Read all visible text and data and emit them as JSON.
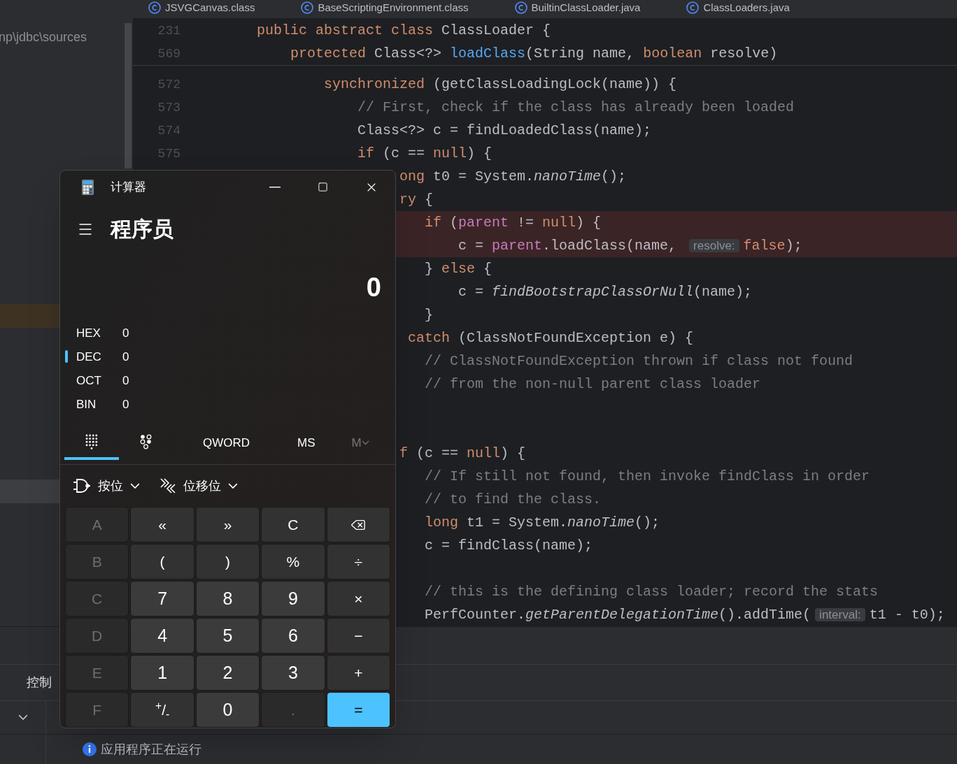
{
  "editor_tabs": [
    {
      "label": "JSVGCanvas.class",
      "selected": false
    },
    {
      "label": "BaseScriptingEnvironment.class",
      "selected": false
    },
    {
      "label": "BuiltinClassLoader.java",
      "selected": false
    },
    {
      "label": "ClassLoaders.java",
      "selected": false
    }
  ],
  "project_panel": {
    "path": "np\\jdbc\\sources"
  },
  "sticky_lines": [
    {
      "number": "231",
      "tokens": [
        {
          "text": "public abstract class ",
          "kind": "kw"
        },
        {
          "text": "ClassLoader {",
          "kind": "plain"
        }
      ]
    },
    {
      "number": "569",
      "tokens": [
        {
          "text": "    protected ",
          "kind": "kw"
        },
        {
          "text": "Class<?> ",
          "kind": "plain"
        },
        {
          "text": "loadClass",
          "kind": "call"
        },
        {
          "text": "(String name, ",
          "kind": "plain"
        },
        {
          "text": "boolean ",
          "kind": "kw"
        },
        {
          "text": "resolve)",
          "kind": "plain"
        }
      ]
    }
  ],
  "code_lines": [
    {
      "number": "572",
      "highlighted": false,
      "tokens": [
        {
          "text": "        synchronized ",
          "kind": "kw"
        },
        {
          "text": "(getClassLoadingLock(name)) {",
          "kind": "plain"
        }
      ]
    },
    {
      "number": "573",
      "highlighted": false,
      "tokens": [
        {
          "text": "            // First, check if the class has already been loaded",
          "kind": "comment"
        }
      ]
    },
    {
      "number": "574",
      "highlighted": false,
      "tokens": [
        {
          "text": "            Class<?> c = findLoadedClass(name);",
          "kind": "plain"
        }
      ]
    },
    {
      "number": "575",
      "highlighted": false,
      "tokens": [
        {
          "text": "            if ",
          "kind": "kw"
        },
        {
          "text": "(c == ",
          "kind": "plain"
        },
        {
          "text": "null",
          "kind": "kw"
        },
        {
          "text": ") {",
          "kind": "plain"
        }
      ]
    },
    {
      "highlighted": false,
      "tokens": [
        {
          "text": "                 ong ",
          "kind": "kw"
        },
        {
          "text": "t0 = System.",
          "kind": "plain"
        },
        {
          "text": "nanoTime",
          "kind": "static"
        },
        {
          "text": "();",
          "kind": "plain"
        }
      ]
    },
    {
      "highlighted": false,
      "tokens": [
        {
          "text": "                 ry ",
          "kind": "kw"
        },
        {
          "text": "{",
          "kind": "plain"
        }
      ]
    },
    {
      "highlighted": true,
      "tokens": [
        {
          "text": "                    if ",
          "kind": "kw"
        },
        {
          "text": "(",
          "kind": "plain"
        },
        {
          "text": "parent",
          "kind": "field"
        },
        {
          "text": " != ",
          "kind": "plain"
        },
        {
          "text": "null",
          "kind": "kw"
        },
        {
          "text": ") {",
          "kind": "plain"
        }
      ]
    },
    {
      "highlighted": true,
      "tokens": [
        {
          "text": "                        c = ",
          "kind": "plain"
        },
        {
          "text": "parent",
          "kind": "field"
        },
        {
          "text": ".loadClass(name, ",
          "kind": "plain"
        },
        {
          "text": "resolve:",
          "kind": "hint"
        },
        {
          "text": "false",
          "kind": "kw"
        },
        {
          "text": ");",
          "kind": "plain"
        }
      ]
    },
    {
      "highlighted": false,
      "tokens": [
        {
          "text": "                    } ",
          "kind": "plain"
        },
        {
          "text": "else ",
          "kind": "kw"
        },
        {
          "text": "{",
          "kind": "plain"
        }
      ]
    },
    {
      "highlighted": false,
      "tokens": [
        {
          "text": "                        c = ",
          "kind": "plain"
        },
        {
          "text": "findBootstrapClassOrNull",
          "kind": "static"
        },
        {
          "text": "(name);",
          "kind": "plain"
        }
      ]
    },
    {
      "highlighted": false,
      "tokens": [
        {
          "text": "                    }",
          "kind": "plain"
        }
      ]
    },
    {
      "highlighted": false,
      "tokens": [
        {
          "text": "                  catch ",
          "kind": "kw"
        },
        {
          "text": "(ClassNotFoundException e) {",
          "kind": "plain"
        }
      ]
    },
    {
      "highlighted": false,
      "tokens": [
        {
          "text": "                    // ClassNotFoundException thrown if class not found",
          "kind": "comment"
        }
      ]
    },
    {
      "highlighted": false,
      "tokens": [
        {
          "text": "                    // from the non-null parent class loader",
          "kind": "comment"
        }
      ]
    },
    {
      "highlighted": false
    },
    {
      "highlighted": false
    },
    {
      "highlighted": false,
      "tokens": [
        {
          "text": "                 f ",
          "kind": "kw"
        },
        {
          "text": "(c == ",
          "kind": "plain"
        },
        {
          "text": "null",
          "kind": "kw"
        },
        {
          "text": ") {",
          "kind": "plain"
        }
      ]
    },
    {
      "highlighted": false,
      "tokens": [
        {
          "text": "                    // If still not found, then invoke findClass in order",
          "kind": "comment"
        }
      ]
    },
    {
      "highlighted": false,
      "tokens": [
        {
          "text": "                    // to find the class.",
          "kind": "comment"
        }
      ]
    },
    {
      "highlighted": false,
      "tokens": [
        {
          "text": "                    long ",
          "kind": "kw"
        },
        {
          "text": "t1 = System.",
          "kind": "plain"
        },
        {
          "text": "nanoTime",
          "kind": "static"
        },
        {
          "text": "();",
          "kind": "plain"
        }
      ]
    },
    {
      "highlighted": false,
      "tokens": [
        {
          "text": "                    c = findClass(name);",
          "kind": "plain"
        }
      ]
    },
    {
      "highlighted": false
    },
    {
      "highlighted": false,
      "tokens": [
        {
          "text": "                    // this is the defining class loader; record the stats",
          "kind": "comment"
        }
      ]
    },
    {
      "highlighted": false,
      "tokens": [
        {
          "text": "                    PerfCounter.",
          "kind": "plain"
        },
        {
          "text": "getParentDelegationTime",
          "kind": "static"
        },
        {
          "text": "().addTime(",
          "kind": "plain"
        },
        {
          "text": "interval:",
          "kind": "hint"
        },
        {
          "text": "t1 - t0);",
          "kind": "plain"
        }
      ]
    }
  ],
  "console": {
    "tab": "控制",
    "status": "应用程序正在运行"
  },
  "calculator": {
    "title": "计算器",
    "mode": "程序员",
    "display": "0",
    "radix": [
      {
        "label": "HEX",
        "value": "0",
        "selected": false
      },
      {
        "label": "DEC",
        "value": "0",
        "selected": true
      },
      {
        "label": "OCT",
        "value": "0",
        "selected": false
      },
      {
        "label": "BIN",
        "value": "0",
        "selected": false
      }
    ],
    "views": [
      {
        "kind": "keypad",
        "selected": true
      },
      {
        "kind": "bits",
        "selected": false
      }
    ],
    "word_size": "QWORD",
    "memory_buttons": [
      {
        "label": "MS",
        "kind": "button",
        "disabled": false
      },
      {
        "label": "M",
        "kind": "menu",
        "disabled": true
      }
    ],
    "menus": [
      {
        "kind": "bitwise",
        "label": "按位"
      },
      {
        "kind": "shift",
        "label": "位移位"
      }
    ],
    "keys": [
      {
        "label": "A",
        "kind": "digit",
        "disabled": true
      },
      {
        "label": "«",
        "kind": "op",
        "disabled": false
      },
      {
        "label": "»",
        "kind": "op",
        "disabled": false
      },
      {
        "label": "C",
        "kind": "op",
        "disabled": false
      },
      {
        "kind": "backspace",
        "disabled": false
      },
      {
        "label": "B",
        "kind": "digit",
        "disabled": true
      },
      {
        "label": "(",
        "kind": "op",
        "disabled": false
      },
      {
        "label": ")",
        "kind": "op",
        "disabled": false
      },
      {
        "label": "%",
        "kind": "op",
        "disabled": false
      },
      {
        "label": "÷",
        "kind": "op",
        "disabled": false
      },
      {
        "label": "C",
        "kind": "digit",
        "disabled": true
      },
      {
        "label": "7",
        "kind": "digit",
        "disabled": false
      },
      {
        "label": "8",
        "kind": "digit",
        "disabled": false
      },
      {
        "label": "9",
        "kind": "digit",
        "disabled": false
      },
      {
        "label": "×",
        "kind": "op",
        "disabled": false
      },
      {
        "label": "D",
        "kind": "digit",
        "disabled": true
      },
      {
        "label": "4",
        "kind": "digit",
        "disabled": false
      },
      {
        "label": "5",
        "kind": "digit",
        "disabled": false
      },
      {
        "label": "6",
        "kind": "digit",
        "disabled": false
      },
      {
        "label": "−",
        "kind": "op",
        "disabled": false
      },
      {
        "label": "E",
        "kind": "digit",
        "disabled": true
      },
      {
        "label": "1",
        "kind": "digit",
        "disabled": false
      },
      {
        "label": "2",
        "kind": "digit",
        "disabled": false
      },
      {
        "label": "3",
        "kind": "digit",
        "disabled": false
      },
      {
        "label": "+",
        "kind": "op",
        "disabled": false
      },
      {
        "label": "F",
        "kind": "digit",
        "disabled": true
      },
      {
        "label": "$^{+}$/$_{-}$",
        "kind": "op",
        "disabled": false
      },
      {
        "label": "0",
        "kind": "digit",
        "disabled": false
      },
      {
        "label": ".",
        "kind": "digit",
        "disabled": true
      },
      {
        "label": "=",
        "kind": "equals",
        "disabled": false
      }
    ]
  }
}
